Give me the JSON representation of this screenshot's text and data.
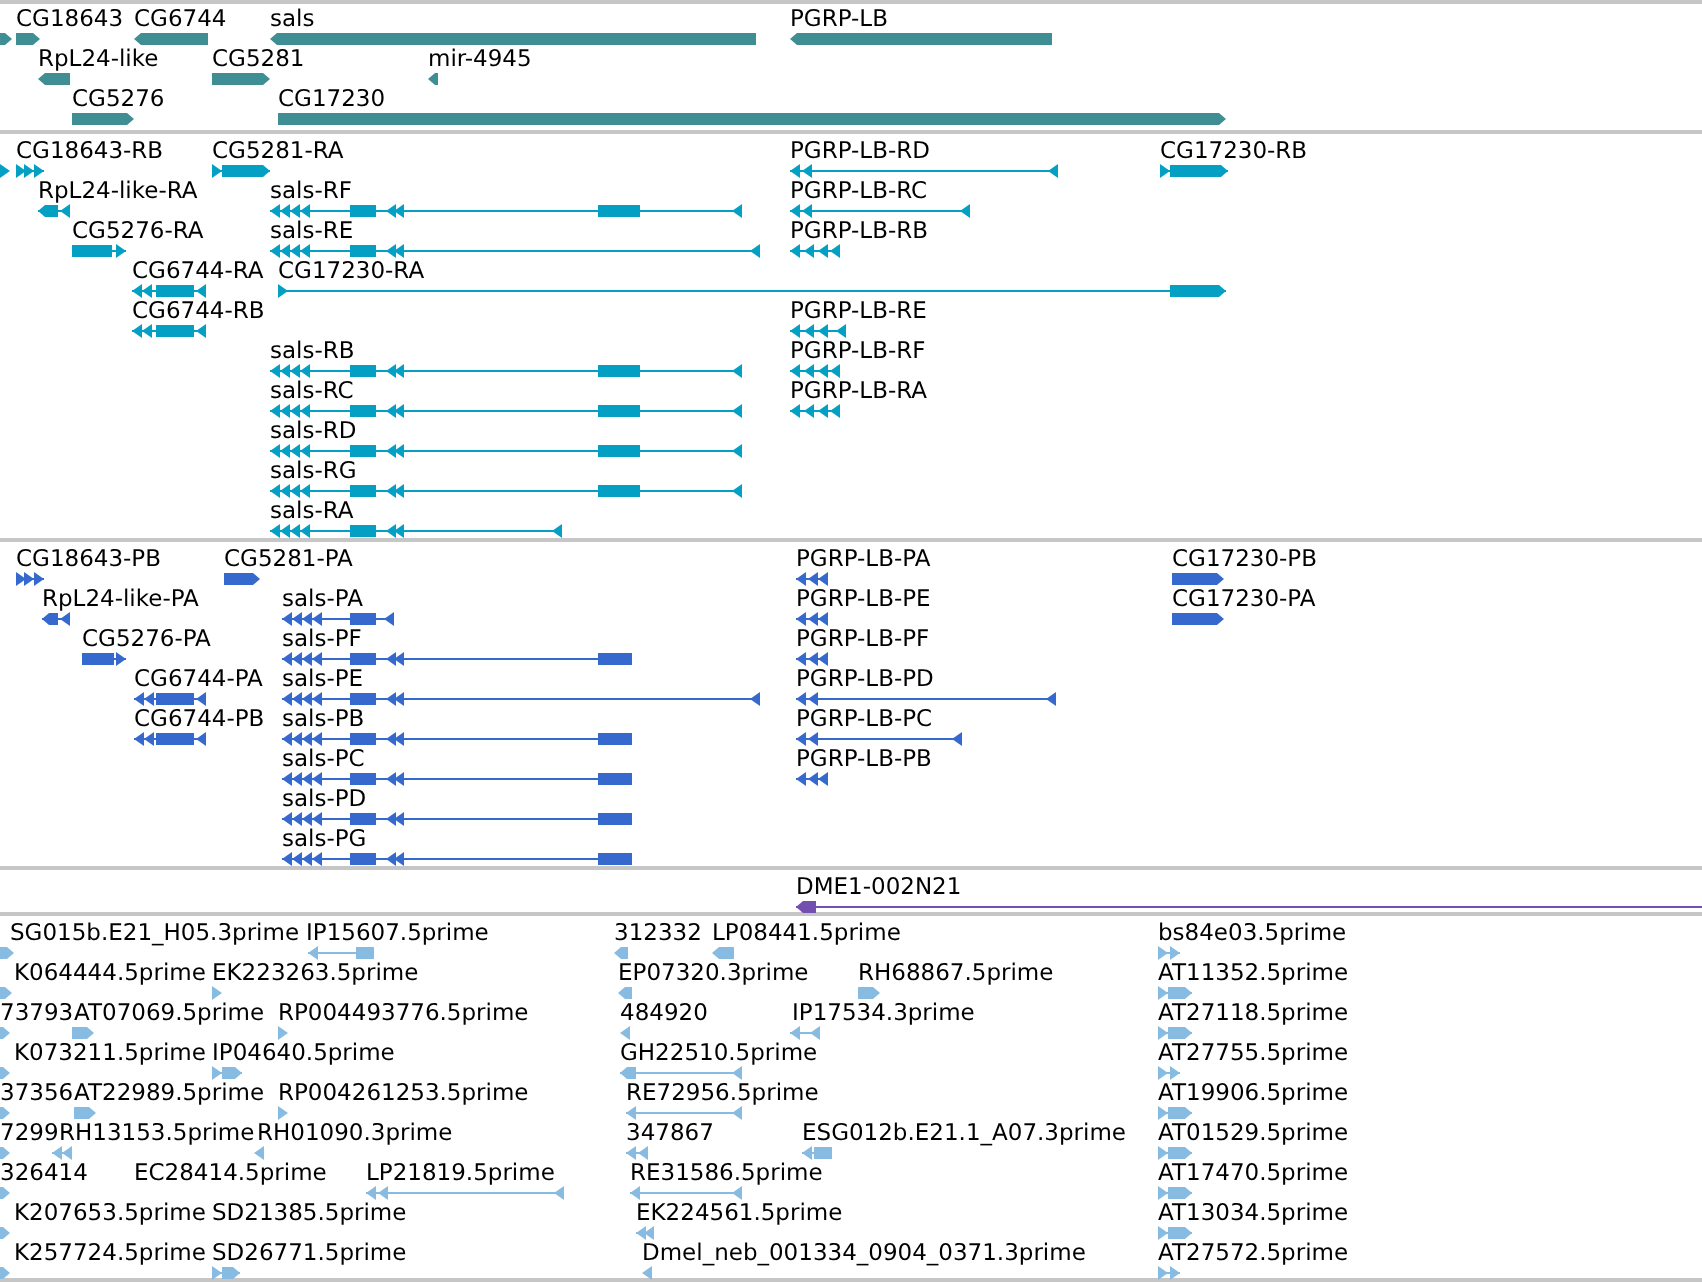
{
  "tracks": [
    {
      "color": "#3f8e94",
      "rows": [
        {
          "features": [
            {
              "kind": "forward"
            },
            {
              "label": "CG18643",
              "kind": "forward"
            },
            {
              "label": "CG6744",
              "kind": "reverse"
            },
            {
              "label": "sals",
              "kind": "reverse"
            },
            {
              "label": "PGRP-LB",
              "kind": "reverse"
            }
          ]
        },
        {
          "features": [
            {
              "label": "RpL24-like",
              "kind": "reverse"
            },
            {
              "label": "CG5281",
              "kind": "forward"
            },
            {
              "label": "mir-4945",
              "kind": "reverse"
            }
          ]
        },
        {
          "features": [
            {
              "label": "CG5276",
              "kind": "forward"
            },
            {
              "label": "CG17230",
              "kind": "forward"
            }
          ]
        }
      ]
    },
    {
      "color": "#04a0c4",
      "rows": [
        {
          "features": [
            {
              "kind": "forward"
            },
            {
              "label": "CG18643-RB",
              "kind": "forward"
            },
            {
              "label": "CG5281-RA",
              "kind": "forward"
            },
            {
              "label": "PGRP-LB-RD",
              "kind": "reverse"
            },
            {
              "label": "CG17230-RB",
              "kind": "forward"
            }
          ]
        },
        {
          "features": [
            {
              "label": "RpL24-like-RA",
              "kind": "reverse"
            },
            {
              "label": "sals-RF",
              "kind": "reverse"
            },
            {
              "label": "PGRP-LB-RC",
              "kind": "reverse"
            }
          ]
        },
        {
          "features": [
            {
              "label": "CG5276-RA",
              "kind": "forward"
            },
            {
              "label": "sals-RE",
              "kind": "reverse"
            },
            {
              "label": "PGRP-LB-RB",
              "kind": "reverse"
            }
          ]
        },
        {
          "features": [
            {
              "label": "CG6744-RA",
              "kind": "reverse"
            },
            {
              "label": "CG17230-RA",
              "kind": "forward"
            }
          ]
        },
        {
          "features": [
            {
              "label": "CG6744-RB",
              "kind": "reverse"
            },
            {
              "label": "PGRP-LB-RE",
              "kind": "reverse"
            }
          ]
        },
        {
          "features": [
            {
              "label": "sals-RB",
              "kind": "reverse"
            },
            {
              "label": "PGRP-LB-RF",
              "kind": "reverse"
            }
          ]
        },
        {
          "features": [
            {
              "label": "sals-RC",
              "kind": "reverse"
            },
            {
              "label": "PGRP-LB-RA",
              "kind": "reverse"
            }
          ]
        },
        {
          "features": [
            {
              "label": "sals-RD",
              "kind": "reverse"
            }
          ]
        },
        {
          "features": [
            {
              "label": "sals-RG",
              "kind": "reverse"
            }
          ]
        },
        {
          "features": [
            {
              "label": "sals-RA",
              "kind": "reverse"
            }
          ]
        }
      ]
    },
    {
      "color": "#3569cd",
      "rows": [
        {
          "features": [
            {
              "label": "CG18643-PB",
              "kind": "forward"
            },
            {
              "label": "CG5281-PA",
              "kind": "forward"
            },
            {
              "label": "PGRP-LB-PA",
              "kind": "reverse"
            },
            {
              "label": "CG17230-PB",
              "kind": "forward"
            }
          ]
        },
        {
          "features": [
            {
              "label": "RpL24-like-PA",
              "kind": "reverse"
            },
            {
              "label": "sals-PA",
              "kind": "reverse"
            },
            {
              "label": "PGRP-LB-PE",
              "kind": "reverse"
            },
            {
              "label": "CG17230-PA",
              "kind": "forward"
            }
          ]
        },
        {
          "features": [
            {
              "label": "CG5276-PA",
              "kind": "forward"
            },
            {
              "label": "sals-PF",
              "kind": "reverse"
            },
            {
              "label": "PGRP-LB-PF",
              "kind": "reverse"
            }
          ]
        },
        {
          "features": [
            {
              "label": "CG6744-PA",
              "kind": "reverse"
            },
            {
              "label": "sals-PE",
              "kind": "reverse"
            },
            {
              "label": "PGRP-LB-PD",
              "kind": "reverse"
            }
          ]
        },
        {
          "features": [
            {
              "label": "CG6744-PB",
              "kind": "reverse"
            },
            {
              "label": "sals-PB",
              "kind": "reverse"
            },
            {
              "label": "PGRP-LB-PC",
              "kind": "reverse"
            }
          ]
        },
        {
          "features": [
            {
              "label": "sals-PC",
              "kind": "reverse"
            },
            {
              "label": "PGRP-LB-PB",
              "kind": "reverse"
            }
          ]
        },
        {
          "features": [
            {
              "label": "sals-PD",
              "kind": "reverse"
            }
          ]
        },
        {
          "features": [
            {
              "label": "sals-PG",
              "kind": "reverse"
            }
          ]
        }
      ]
    },
    {
      "color": "#7350b0",
      "rows": [
        {
          "features": [
            {
              "label": "DME1-002N21",
              "kind": "reverse"
            }
          ]
        }
      ]
    },
    {
      "color": "#88bbe1",
      "rows": [
        {
          "features": [
            {
              "label": "SG015b.E21_H05.3prime",
              "kind": "forward"
            },
            {
              "label": "IP15607.5prime",
              "kind": "reverse"
            },
            {
              "label": "312332",
              "kind": "reverse"
            },
            {
              "label": "LP08441.5prime",
              "kind": "reverse"
            },
            {
              "label": "bs84e03.5prime",
              "kind": "forward"
            }
          ]
        },
        {
          "features": [
            {
              "label": "K064444.5prime",
              "kind": "forward"
            },
            {
              "label": "EK223263.5prime",
              "kind": "forward"
            },
            {
              "label": "EP07320.3prime",
              "kind": "reverse"
            },
            {
              "label": "RH68867.5prime",
              "kind": "forward"
            },
            {
              "label": "AT11352.5prime",
              "kind": "forward"
            }
          ]
        },
        {
          "features": [
            {
              "label": "73793",
              "kind": "forward"
            },
            {
              "label": "AT07069.5prime",
              "kind": "forward"
            },
            {
              "label": "RP004493776.5prime",
              "kind": "forward"
            },
            {
              "label": "484920",
              "kind": "reverse"
            },
            {
              "label": "IP17534.3prime",
              "kind": "reverse"
            },
            {
              "label": "AT27118.5prime",
              "kind": "forward"
            }
          ]
        },
        {
          "features": [
            {
              "label": "K073211.5prime",
              "kind": "forward"
            },
            {
              "label": "IP04640.5prime",
              "kind": "forward"
            },
            {
              "label": "GH22510.5prime",
              "kind": "reverse"
            },
            {
              "label": "AT27755.5prime",
              "kind": "forward"
            }
          ]
        },
        {
          "features": [
            {
              "label": "37356",
              "kind": "forward"
            },
            {
              "label": "AT22989.5prime",
              "kind": "forward"
            },
            {
              "label": "RP004261253.5prime",
              "kind": "forward"
            },
            {
              "label": "RE72956.5prime",
              "kind": "reverse"
            },
            {
              "label": "AT19906.5prime",
              "kind": "forward"
            }
          ]
        },
        {
          "features": [
            {
              "label": "7299",
              "kind": "forward"
            },
            {
              "label": "RH13153.5prime",
              "kind": "reverse"
            },
            {
              "label": "RH01090.3prime",
              "kind": "reverse"
            },
            {
              "label": "347867",
              "kind": "reverse"
            },
            {
              "label": "ESG012b.E21.1_A07.3prime",
              "kind": "reverse"
            },
            {
              "label": "AT01529.5prime",
              "kind": "forward"
            }
          ]
        },
        {
          "features": [
            {
              "label": "326414",
              "kind": "forward"
            },
            {
              "label": "EC28414.5prime"
            },
            {
              "label": "LP21819.5prime",
              "kind": "reverse"
            },
            {
              "label": "RE31586.5prime",
              "kind": "reverse"
            },
            {
              "label": "AT17470.5prime",
              "kind": "forward"
            }
          ]
        },
        {
          "features": [
            {
              "label": "K207653.5prime",
              "kind": "forward"
            },
            {
              "label": "SD21385.5prime"
            },
            {
              "label": "EK224561.5prime",
              "kind": "reverse"
            },
            {
              "label": "AT13034.5prime",
              "kind": "forward"
            }
          ]
        },
        {
          "features": [
            {
              "label": "K257724.5prime",
              "kind": "forward"
            },
            {
              "label": "SD26771.5prime",
              "kind": "forward"
            },
            {
              "label": "Dmel_neb_001334_0904_0371.3prime",
              "kind": "reverse"
            },
            {
              "label": "AT27572.5prime",
              "kind": "forward"
            }
          ]
        }
      ]
    }
  ]
}
